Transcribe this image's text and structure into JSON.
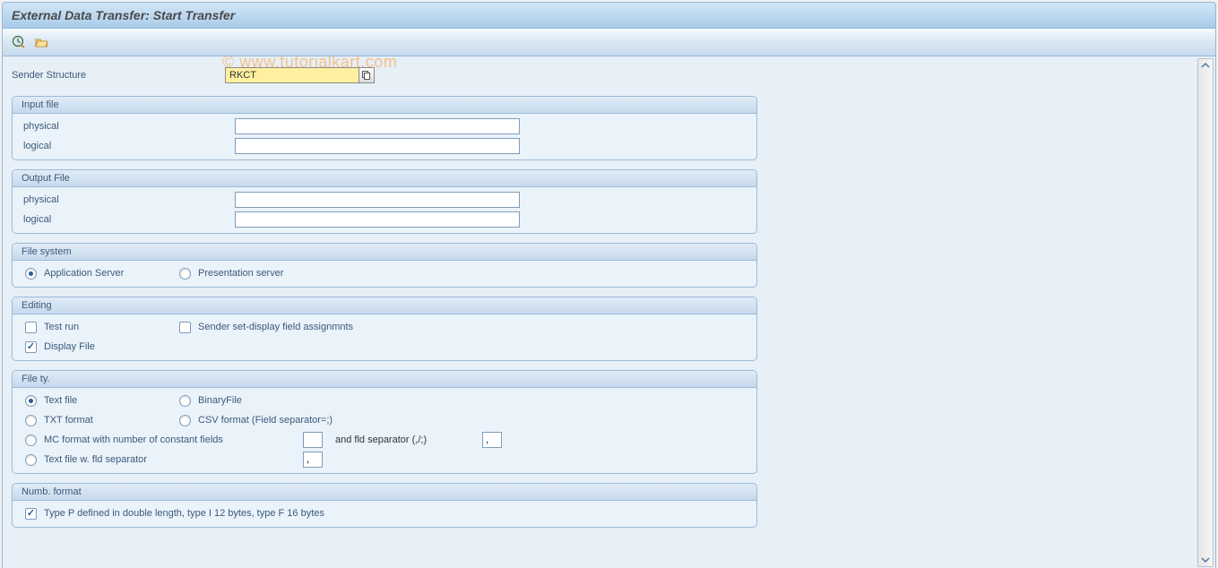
{
  "title": "External Data Transfer: Start Transfer",
  "watermark": "© www.tutorialkart.com",
  "sender_structure": {
    "label": "Sender Structure",
    "value": "RKCT"
  },
  "groups": {
    "input_file": {
      "title": "Input file",
      "physical_label": "physical",
      "physical_value": "",
      "logical_label": "logical",
      "logical_value": ""
    },
    "output_file": {
      "title": "Output File",
      "physical_label": "physical",
      "physical_value": "",
      "logical_label": "logical",
      "logical_value": ""
    },
    "file_system": {
      "title": "File system",
      "application_server": "Application Server",
      "presentation_server": "Presentation server"
    },
    "editing": {
      "title": "Editing",
      "test_run": "Test run",
      "sender_set_display": "Sender set-display field assignmnts",
      "display_file": "Display File"
    },
    "file_type": {
      "title": "File ty.",
      "text_file": "Text file",
      "binary_file": "BinaryFile",
      "txt_format": "TXT format",
      "csv_format": "CSV format (Field separator=;)",
      "mc_format": "MC format with number of constant fields",
      "mc_count_value": "",
      "mc_sep_label": "and fld separator (,/;)",
      "mc_sep_value": ",",
      "text_file_sep": "Text file w. fld separator",
      "text_file_sep_value": ","
    },
    "numb_format": {
      "title": "Numb. format",
      "type_p": "Type P defined in double length, type I 12 bytes, type F 16 bytes"
    }
  }
}
